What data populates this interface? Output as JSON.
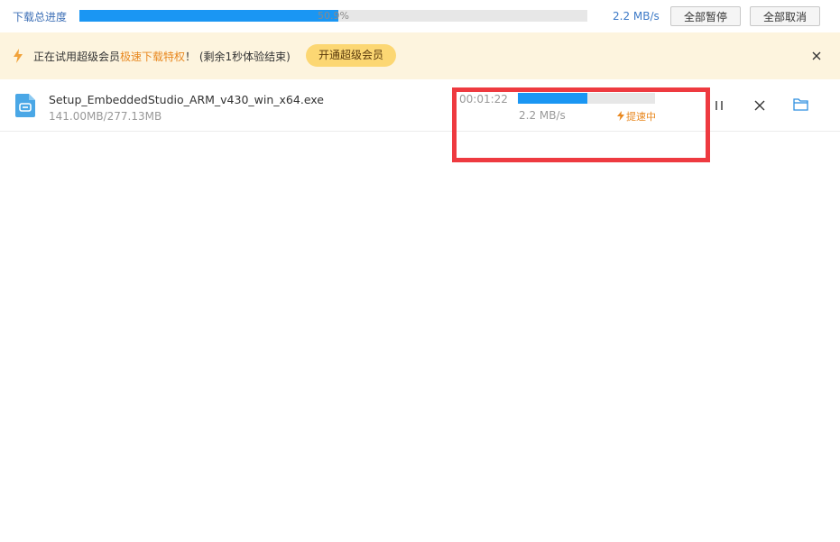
{
  "total_progress": {
    "label": "下载总进度",
    "percent_text": "50.9%",
    "percent": 50.9,
    "speed": "2.2 MB/s"
  },
  "toolbar": {
    "pause_all": "全部暂停",
    "cancel_all": "全部取消"
  },
  "banner": {
    "text_before": "正在试用超级会员",
    "highlight": "极速下载特权",
    "text_after": "！ (剩余1秒体验结束)",
    "vip_button": "开通超级会员",
    "bolt_icon": "lightning-icon",
    "close_icon": "close-icon"
  },
  "downloads": [
    {
      "file_name": "Setup_EmbeddedStudio_ARM_v430_win_x64.exe",
      "size_text": "141.00MB/277.13MB",
      "elapsed": "00:01:22",
      "progress_percent": 50.9,
      "speed": "2.2 MB/s",
      "boost_label": "提速中",
      "icons": [
        "file-icon",
        "pause-icon",
        "delete-icon",
        "folder-icon"
      ]
    }
  ],
  "colors": {
    "progress": "#1a96f3",
    "accent_orange": "#e8871e",
    "banner_bg": "#fdf4de",
    "vip_button": "#fcd773",
    "highlight_box": "#ee3a40"
  }
}
